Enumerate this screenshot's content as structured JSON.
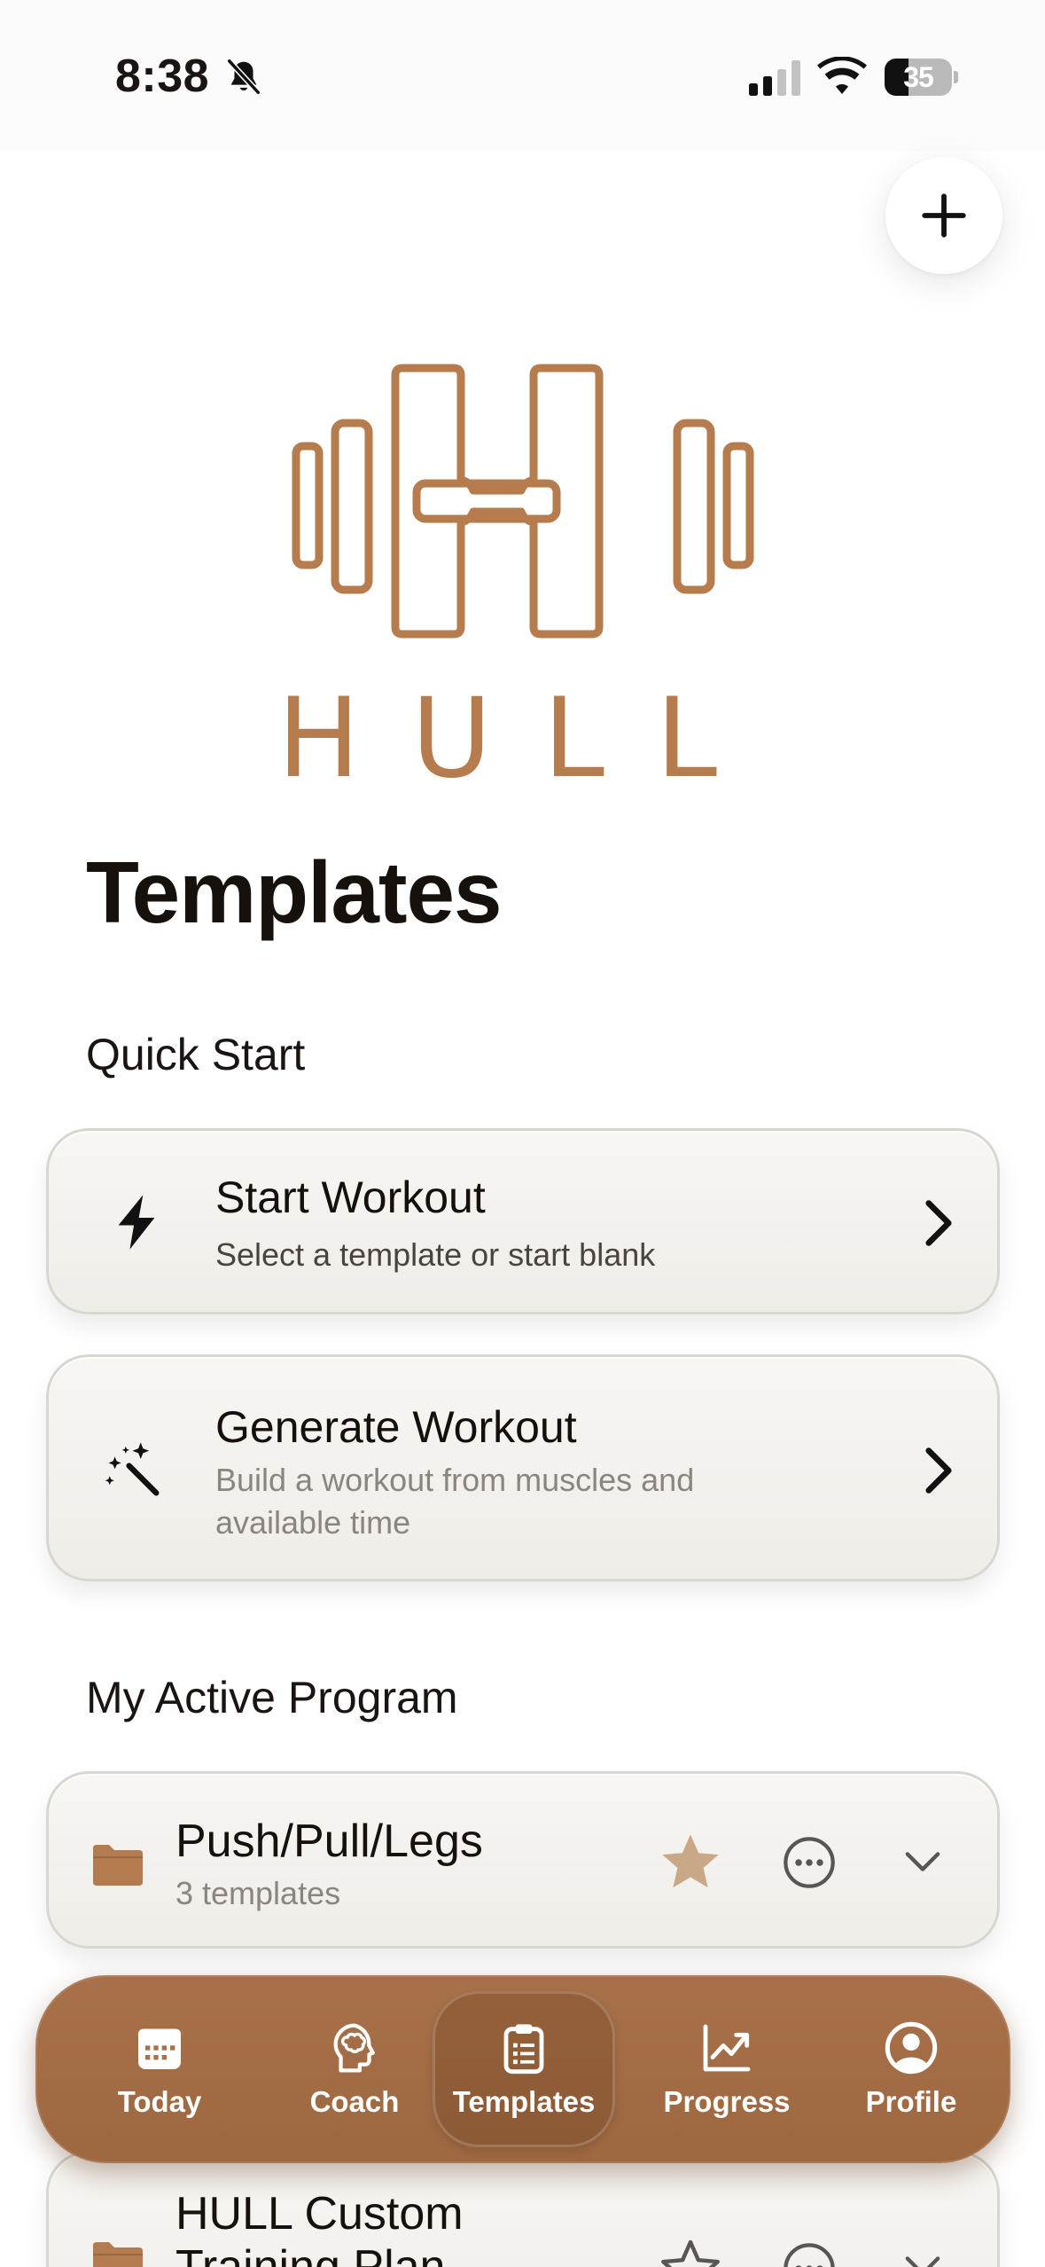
{
  "status_bar": {
    "time": "8:38",
    "battery_level": "35",
    "battery_fraction": 0.35,
    "icons": [
      "bell-slash-icon",
      "cellular-signal-icon",
      "wifi-icon",
      "battery-icon"
    ]
  },
  "header": {
    "add_icon": "plus-icon",
    "logo_text": "HULL"
  },
  "page": {
    "title": "Templates"
  },
  "quick_start": {
    "section_title": "Quick Start",
    "items": [
      {
        "title": "Start Workout",
        "subtitle": "Select a template or start blank",
        "icon": "lightning-bolt-icon"
      },
      {
        "title": "Generate Workout",
        "subtitle": "Build a workout from muscles and available time",
        "icon": "magic-wand-icon"
      }
    ]
  },
  "active_program": {
    "section_title": "My Active Program",
    "programs": [
      {
        "name": "Push/Pull/Legs",
        "count": "3 templates",
        "favorite": true
      },
      {
        "name": "HULL Custom Training Plan",
        "count": "",
        "favorite": false
      }
    ]
  },
  "tab_bar": {
    "tabs": [
      {
        "label": "Today",
        "icon": "calendar-icon"
      },
      {
        "label": "Coach",
        "icon": "brain-head-icon"
      },
      {
        "label": "Templates",
        "icon": "clipboard-icon",
        "selected": true
      },
      {
        "label": "Progress",
        "icon": "chart-line-icon"
      },
      {
        "label": "Profile",
        "icon": "person-circle-icon"
      }
    ]
  },
  "colors": {
    "brand_brown": "#a8714a",
    "logo_brown": "#b67c4e",
    "star_tan": "#c9a887",
    "card_bg": "#f3f1ed"
  }
}
